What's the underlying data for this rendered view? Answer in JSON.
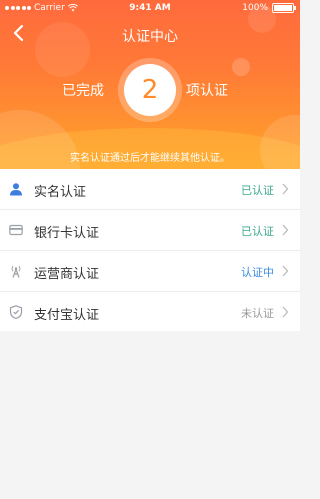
{
  "statusbar": {
    "carrier": "Carrier",
    "time": "9:41 AM",
    "battery": "100%"
  },
  "header": {
    "title": "认证中心"
  },
  "summary": {
    "completed_label": "已完成",
    "count": "2",
    "unit_label": "项认证",
    "hint": "实名认证通过后才能继续其他认证。"
  },
  "colors": {
    "accent_orange": "#ff6a3d",
    "verified_green": "#3aa98a",
    "in_progress_blue": "#3b8ee0",
    "unverified_gray": "#999999"
  },
  "items": [
    {
      "label": "实名认证",
      "status": "已认证",
      "status_type": "verified",
      "icon": "person-icon"
    },
    {
      "label": "银行卡认证",
      "status": "已认证",
      "status_type": "verified",
      "icon": "bank-card-icon"
    },
    {
      "label": "运营商认证",
      "status": "认证中",
      "status_type": "in_progress",
      "icon": "signal-tower-icon"
    },
    {
      "label": "支付宝认证",
      "status": "未认证",
      "status_type": "unverified",
      "icon": "shield-icon"
    }
  ]
}
